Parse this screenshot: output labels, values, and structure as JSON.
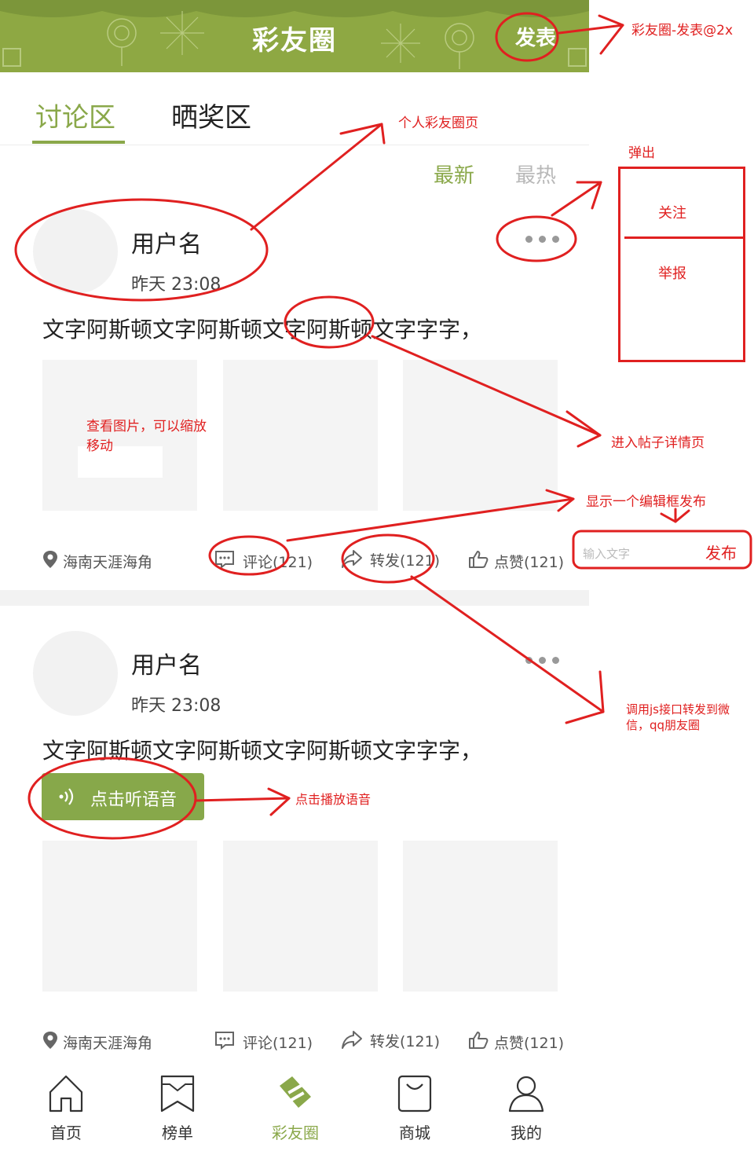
{
  "header": {
    "title": "彩友圈",
    "publish_label": "发表"
  },
  "tabs": [
    {
      "label": "讨论区"
    },
    {
      "label": "晒奖区"
    }
  ],
  "sort": {
    "latest": "最新",
    "hottest": "最热"
  },
  "posts": [
    {
      "username": "用户名",
      "time": "昨天 23:08",
      "text": "文字阿斯顿文字阿斯顿文字阿斯顿文字字字，",
      "location": "海南天涯海角",
      "comment": "评论(121)",
      "forward": "转发(121)",
      "like": "点赞(121)"
    },
    {
      "username": "用户名",
      "time": "昨天 23:08",
      "text": "文字阿斯顿文字阿斯顿文字阿斯顿文字字字，",
      "voice_label": "点击听语音",
      "location": "海南天涯海角",
      "comment": "评论(121)",
      "forward": "转发(121)",
      "like": "点赞(121)"
    }
  ],
  "nav": [
    {
      "label": "首页",
      "icon": "home-icon"
    },
    {
      "label": "榜单",
      "icon": "bookmark-icon"
    },
    {
      "label": "彩友圈",
      "icon": "ticket-icon"
    },
    {
      "label": "商城",
      "icon": "shopping-bag-icon"
    },
    {
      "label": "我的",
      "icon": "user-icon"
    }
  ],
  "annotations": {
    "publish_page": "彩友圈-发表@2x",
    "personal_page": "个人彩友圈页",
    "popup": "弹出",
    "popup_follow": "关注",
    "popup_report": "举报",
    "view_image": "查看图片，可以缩放",
    "view_image_2": "移动",
    "post_detail": "进入帖子详情页",
    "edit_box": "显示一个编辑框发布",
    "input_placeholder": "输入文字",
    "input_publish": "发布",
    "share_wechat": "调用js接口转发到微",
    "share_wechat_2": "信，qq朋友圈",
    "play_voice": "点击播放语音"
  },
  "colors": {
    "header_green": "#8ea843",
    "accent_green": "#8aa84a",
    "annotation_red": "#e02020"
  }
}
